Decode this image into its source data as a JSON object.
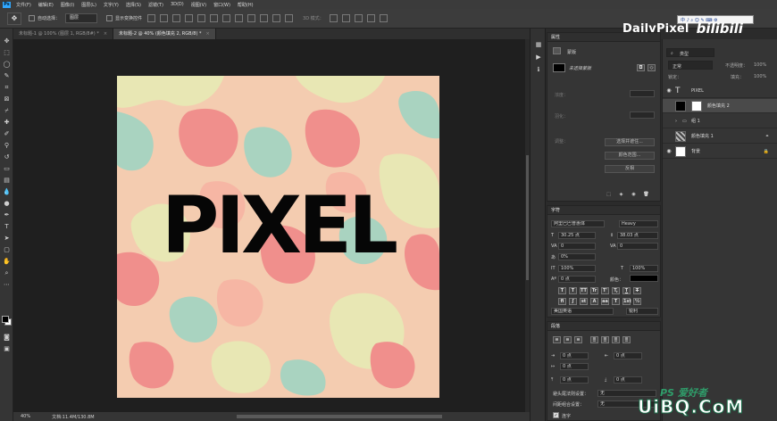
{
  "app": {
    "logo": "Ps",
    "menu": [
      "文件(F)",
      "编辑(E)",
      "图像(I)",
      "图层(L)",
      "文字(Y)",
      "选择(S)",
      "滤镜(T)",
      "3D(D)",
      "视图(V)",
      "窗口(W)",
      "帮助(H)"
    ]
  },
  "options": {
    "auto_select_label": "自动选择：",
    "auto_select_value": "图层",
    "show_transform_label": "显示变换控件",
    "mode3d_label": "3D 模式："
  },
  "brand": {
    "name": "DailyPixel",
    "bilibili": "bilibili"
  },
  "ime": {
    "text": "中 ♪ ⌕ ☺ ✎ ⌨ ⚙"
  },
  "tabs": [
    {
      "label": "未标题-1 @ 100% (图层 1, RGB/8#) *",
      "close": "×",
      "active": false
    },
    {
      "label": "未标题-2 @ 40% (颜色填充 2, RGB/8) *",
      "close": "×",
      "active": true
    }
  ],
  "canvas": {
    "text": "PIXEL"
  },
  "status": {
    "zoom": "40%",
    "doc": "文档:11.4M/130.8M"
  },
  "properties": {
    "title": "属性",
    "mask_label": "蒙版",
    "no_mask": "未选择蒙版",
    "density_label": "浓度：",
    "feather_label": "羽化：",
    "adjust_label": "调整：",
    "select_subject": "选择并遮住...",
    "color_range": "颜色范围...",
    "invert": "反相"
  },
  "character": {
    "title": "字符",
    "font_family": "阿里巴巴普惠体",
    "font_style": "Heavy",
    "font_size": "30.25 点",
    "leading": "38.03 点",
    "kerning": "0",
    "tracking": "0",
    "baseline_pct": "0%",
    "vscale": "100%",
    "hscale": "100%",
    "baseline_shift": "0 点",
    "color_label": "颜色：",
    "language": "美国英语",
    "aa": "锐利",
    "style_buttons": [
      "T",
      "T",
      "TT",
      "Tr",
      "T'",
      "T,",
      "T",
      "T"
    ]
  },
  "paragraph": {
    "title": "段落",
    "indent1": "0 点",
    "indent2": "0 点",
    "indent3": "0 点",
    "space1": "0 点",
    "space2": "0 点",
    "kinsoku_label": "避头尾法则设置：",
    "kinsoku_value": "无",
    "mojikumi_label": "间距组合设置：",
    "mojikumi_value": "无",
    "hyphen_label": "连字"
  },
  "layers": {
    "kind_label": "类型",
    "blend_mode": "正常",
    "opacity_label": "不透明度：",
    "opacity": "100%",
    "lock_label": "锁定：",
    "fill_label": "填充：",
    "fill": "100%",
    "items": [
      {
        "name": "PIXEL",
        "kind": "text",
        "active": false
      },
      {
        "name": "颜色填充 2",
        "kind": "fill",
        "active": true
      },
      {
        "name": "组 1",
        "kind": "group",
        "active": false
      },
      {
        "name": "颜色填充 1",
        "kind": "noise",
        "active": false
      },
      {
        "name": "背景",
        "kind": "bg",
        "active": false
      }
    ]
  },
  "watermark": {
    "ps": "PS 爱好者",
    "site": "UiBQ.CoM"
  }
}
